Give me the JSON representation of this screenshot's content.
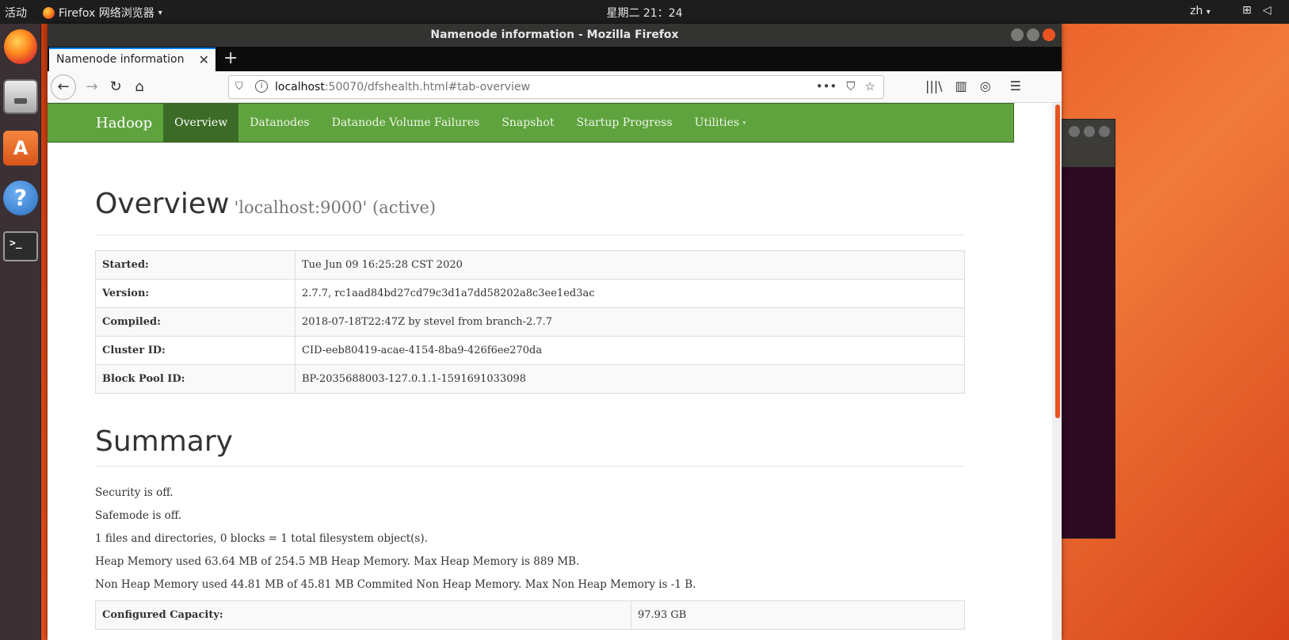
{
  "topbar": {
    "activities": "活动",
    "app_name": "Firefox 网络浏览器",
    "clock": "星期二 21：24",
    "lang": "zh"
  },
  "window": {
    "title": "Namenode information - Mozilla Firefox"
  },
  "tab": {
    "title": "Namenode information"
  },
  "urlbar": {
    "host": "localhost",
    "rest": ":50070/dfshealth.html#tab-overview"
  },
  "hadoop_nav": {
    "brand": "Hadoop",
    "items": [
      "Overview",
      "Datanodes",
      "Datanode Volume Failures",
      "Snapshot",
      "Startup Progress",
      "Utilities"
    ]
  },
  "overview": {
    "heading": "Overview",
    "subheading": "'localhost:9000' (active)",
    "rows": [
      {
        "key": "Started:",
        "value": "Tue Jun 09 16:25:28 CST 2020"
      },
      {
        "key": "Version:",
        "value": "2.7.7, rc1aad84bd27cd79c3d1a7dd58202a8c3ee1ed3ac"
      },
      {
        "key": "Compiled:",
        "value": "2018-07-18T22:47Z by stevel from branch-2.7.7"
      },
      {
        "key": "Cluster ID:",
        "value": "CID-eeb80419-acae-4154-8ba9-426f6ee270da"
      },
      {
        "key": "Block Pool ID:",
        "value": "BP-2035688003-127.0.1.1-1591691033098"
      }
    ]
  },
  "summary": {
    "heading": "Summary",
    "lines": [
      "Security is off.",
      "Safemode is off.",
      "1 files and directories, 0 blocks = 1 total filesystem object(s).",
      "Heap Memory used 63.64 MB of 254.5 MB Heap Memory. Max Heap Memory is 889 MB.",
      "Non Heap Memory used 44.81 MB of 45.81 MB Commited Non Heap Memory. Max Non Heap Memory is -1 B."
    ],
    "capacity": {
      "key": "Configured Capacity:",
      "value": "97.93 GB"
    }
  },
  "icons": {
    "dock": [
      "firefox-icon",
      "files-icon",
      "software-store-icon",
      "help-icon",
      "terminal-icon"
    ],
    "store_glyph": "A",
    "help_glyph": "?",
    "terminal_glyph": ">_",
    "tab_close_glyph": "✕",
    "newtab_glyph": "+",
    "back_glyph": "←",
    "forward_glyph": "→",
    "reload_glyph": "↻",
    "home_glyph": "⌂",
    "more_glyph": "•••",
    "pocket_glyph": "⛉",
    "bookmark_glyph": "☆",
    "library_glyph": "|||\\",
    "sidebar_glyph": "▥",
    "account_glyph": "◎",
    "menu_glyph": "☰",
    "caret_glyph": "▾"
  },
  "colors": {
    "hadoop_green": "#5fa33e",
    "active_tab_green": "#3b6b26",
    "ubuntu_orange": "#e95420"
  }
}
